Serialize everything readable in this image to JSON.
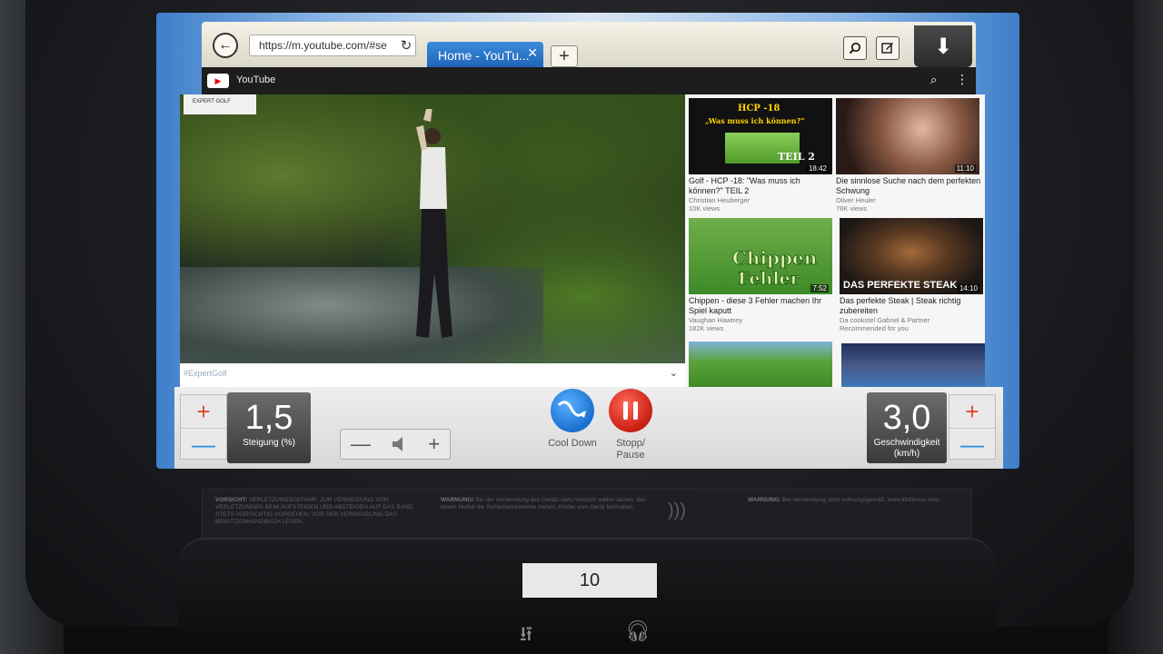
{
  "browser": {
    "url": "https://m.youtube.com/#se",
    "tab_title": "Home - YouTu...",
    "tab_close": "✕",
    "add_tab": "+"
  },
  "youtube": {
    "header_title": "YouTube",
    "video_brand": "EXPERT GOLF",
    "video_hashtag": "#ExpertGolf",
    "recommendations": [
      {
        "title": "Golf - HCP -18: \"Was muss ich können?\" TEIL 2",
        "channel": "Christian Heuberger",
        "views": "10K views",
        "duration": "18:42",
        "thumb_text_1": "HCP -18",
        "thumb_text_2": "„Was muss ich können?“",
        "thumb_text_3": "TEIL 2"
      },
      {
        "title": "Die sinnlose Suche nach dem perfekten Schwung",
        "channel": "Oliver Heuler",
        "views": "78K views",
        "duration": "11:10"
      },
      {
        "title": "Chippen - diese 3 Fehler machen Ihr Spiel kaputt",
        "channel": "Vaughan Hawtrey",
        "views": "182K views",
        "duration": "7:52",
        "thumb_text_1": "Chippen",
        "thumb_text_2": "Fehler"
      },
      {
        "title": "Das perfekte Steak | Steak richtig zubereiten",
        "channel": "Da cookstel Gabriel & Partner",
        "views": "Recommended for you",
        "duration": "14:10",
        "thumb_text_1": "DAS PERFEKTE STEAK"
      }
    ]
  },
  "controls": {
    "incline_value": "1,5",
    "incline_label": "Steigung (%)",
    "speed_value": "3,0",
    "speed_label": "Geschwindigkeit (km/h)",
    "plus": "+",
    "minus": "—",
    "cooldown_label": "Cool Down",
    "pause_label": "Stopp/ Pause"
  },
  "hardware": {
    "machine_number": "10",
    "warning_1_title": "VORSICHT:",
    "warning_1_text": "VERLETZUNGSGEFAHR. ZUR VERMEIDUNG VON VERLETZUNGEN BEIM AUFSTEIGEN UND ABSTEIGEN AUF DAS BAND STETS VORSICHTIG VORGEHEN. VOR DER VERWENDUNG DAS BENUTZERHANDBUCH LESEN.",
    "warning_2_title": "WARNUNG!",
    "warning_2_text": "Bei der Verwendung des Geräts stets Vorsicht walten lassen. Bei einem Notfall die Sicherheitsklemme ziehen. Kinder vom Gerät fernhalten.",
    "warning_3_title": "WARNUNG:",
    "warning_3_text": "Bei Verwendung nicht ordnungsgemäß. www.lifefitness.com"
  },
  "colors": {
    "tab_active": "#1e62b5",
    "plus_red": "#e04a2a",
    "minus_blue": "#2a8fe0",
    "cooldown_blue": "#1a6fd0",
    "pause_red": "#c81e12"
  },
  "icons": [
    "back-arrow-icon",
    "reload-icon",
    "search-icon",
    "edit-icon",
    "download-icon",
    "youtube-logo-icon",
    "more-icon",
    "chevron-down-icon",
    "speaker-icon",
    "cooldown-icon",
    "pause-icon",
    "nfc-icon",
    "usb-icon",
    "headphone-icon"
  ]
}
